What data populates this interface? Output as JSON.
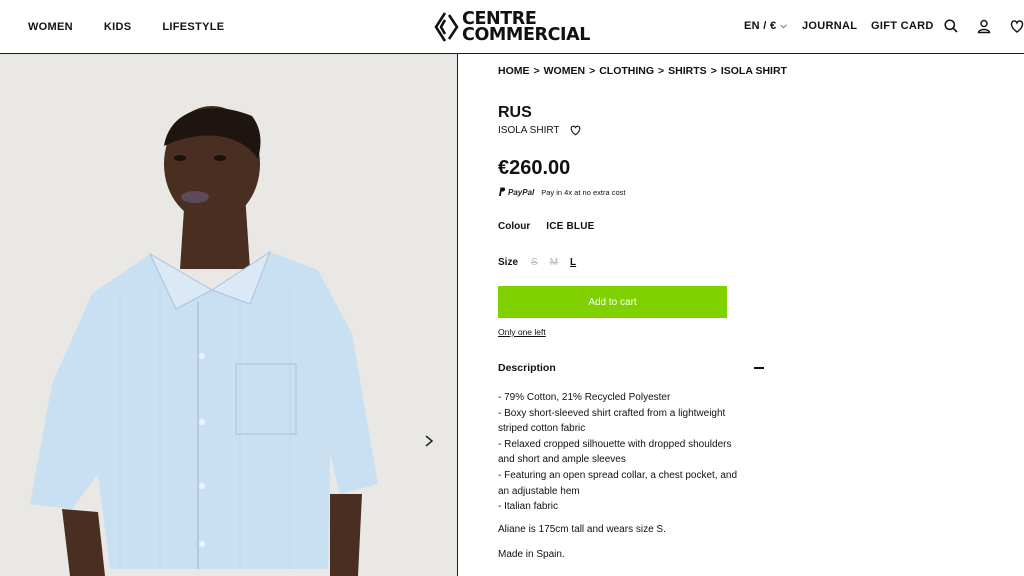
{
  "header": {
    "nav_left": [
      "WOMEN",
      "KIDS",
      "LIFESTYLE"
    ],
    "logo_line1": "CENTRE",
    "logo_line2": "COMMERCIAL",
    "locale": "EN / €",
    "journal": "JOURNAL",
    "gift_card": "GIFT CARD"
  },
  "breadcrumb": [
    "HOME",
    "WOMEN",
    "CLOTHING",
    "SHIRTS",
    "ISOLA SHIRT"
  ],
  "product": {
    "brand": "RUS",
    "name": "ISOLA SHIRT",
    "price": "€260.00",
    "paypal_brand": "PayPal",
    "paypal_text": "Pay in 4x at no extra cost",
    "colour_label": "Colour",
    "colour_value": "ICE BLUE",
    "size_label": "Size",
    "sizes": [
      "S",
      "M",
      "L"
    ],
    "selected_size": "L",
    "add_to_cart": "Add to cart",
    "stock": "Only one left"
  },
  "description": {
    "title": "Description",
    "lines": [
      "- 79% Cotton, 21% Recycled Polyester",
      "- Boxy short-sleeved shirt crafted from a lightweight",
      "striped cotton fabric",
      "- Relaxed cropped silhouette with dropped shoulders",
      "and short and ample sleeves",
      "- Featuring an open spread collar, a chest pocket, and",
      "an adjustable hem",
      "- Italian fabric"
    ],
    "model_note": "Aliane is 175cm tall and wears size S.",
    "origin": "Made in Spain."
  },
  "colors": {
    "accent_green": "#7fd100",
    "shirt_blue": "#c9dff2",
    "background": "#e9e8e4"
  }
}
